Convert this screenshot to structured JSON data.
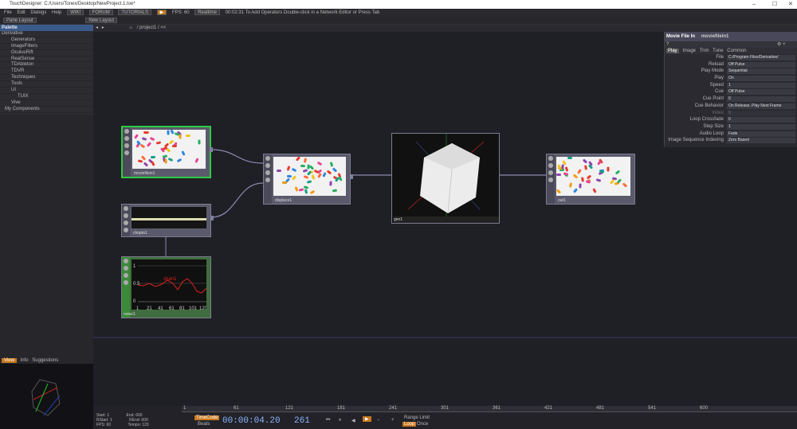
{
  "window": {
    "title": "TouchDesigner: C:/Users/Tonex/Desktop/NewProject.1.toe*",
    "build": "TouchDesigner"
  },
  "menu": {
    "items": [
      "File",
      "Edit",
      "Dialogs",
      "Help"
    ],
    "wiki": "WIKI",
    "forum": "FORUM",
    "tutorials": "TUTORIALS",
    "fps_label": "FPS: 60",
    "realtime": "Realtime",
    "status": "00:02:31 To Add Operators Double-click in a Network Editor or Press Tab"
  },
  "pane": {
    "layout": "Pane Layout",
    "new_layout": "New Layout"
  },
  "palette": {
    "title": "Palette",
    "items": [
      "Derivative",
      "Generators",
      "ImageFilters",
      "OculusRift",
      "RealSense",
      "TDAbleton",
      "TDVR",
      "Techniques",
      "Tools",
      "UI",
      "TUIX",
      "Vive",
      "My Components"
    ]
  },
  "network": {
    "path": "/ project1 / <<"
  },
  "nodes": {
    "moviefilein1": "moviefilein1",
    "displace1": "displace1",
    "geo1": "geo1",
    "out1": "out1",
    "chopto1": "chopto1",
    "noise1": "noise1",
    "noise_label": "chan1",
    "noise_ticks": [
      "1",
      "21",
      "41",
      "61",
      "81",
      "101",
      "120"
    ],
    "noise_y": [
      "1",
      "0.5",
      "0"
    ]
  },
  "params": {
    "op_type": "Movie File In",
    "op_name": "moviefilein1",
    "tabs": [
      "Play",
      "Image",
      "Trim",
      "Tune",
      "Common"
    ],
    "rows": [
      {
        "l": "File",
        "v": "C:/Program Files/Derivative/"
      },
      {
        "l": "Reload",
        "v": "Off    Pulse"
      },
      {
        "l": "Play Mode",
        "v": "Sequential"
      },
      {
        "l": "Play",
        "v": "On"
      },
      {
        "l": "Speed",
        "v": "1"
      },
      {
        "l": "Cue",
        "v": "Off    Pulse"
      },
      {
        "l": "Cue Point",
        "v": "0"
      },
      {
        "l": "Cue Behavior",
        "v": "On Release, Play Next Frame"
      },
      {
        "l": "Index",
        "v": "0"
      },
      {
        "l": "Loop Crossfade",
        "v": "0"
      },
      {
        "l": "Step Size",
        "v": "1"
      },
      {
        "l": "Audio Loop",
        "v": "Fade"
      },
      {
        "l": "Image Sequence Indexing",
        "v": "Zero Based"
      }
    ]
  },
  "viewer": {
    "tabs": [
      "View",
      "Info",
      "Suggestions"
    ]
  },
  "timeline": {
    "start": "Start:",
    "start_v": "1",
    "end": "End:",
    "end_v": "600",
    "rstart": "RStart:",
    "rstart_v": "1",
    "rend": "REnd:",
    "rend_v": "600",
    "fps": "FPS:",
    "fps_v": "60",
    "tempo": "Tempo:",
    "tempo_v": "120",
    "timecode": "TimeCode",
    "beats": "Beats",
    "time": "00:00:04.20",
    "frame": "261",
    "range": "Range Limit",
    "loop": "Loop",
    "once": "Once",
    "ticks": [
      "1",
      "61",
      "121",
      "181",
      "241",
      "301",
      "361",
      "421",
      "481",
      "541",
      "600"
    ]
  }
}
